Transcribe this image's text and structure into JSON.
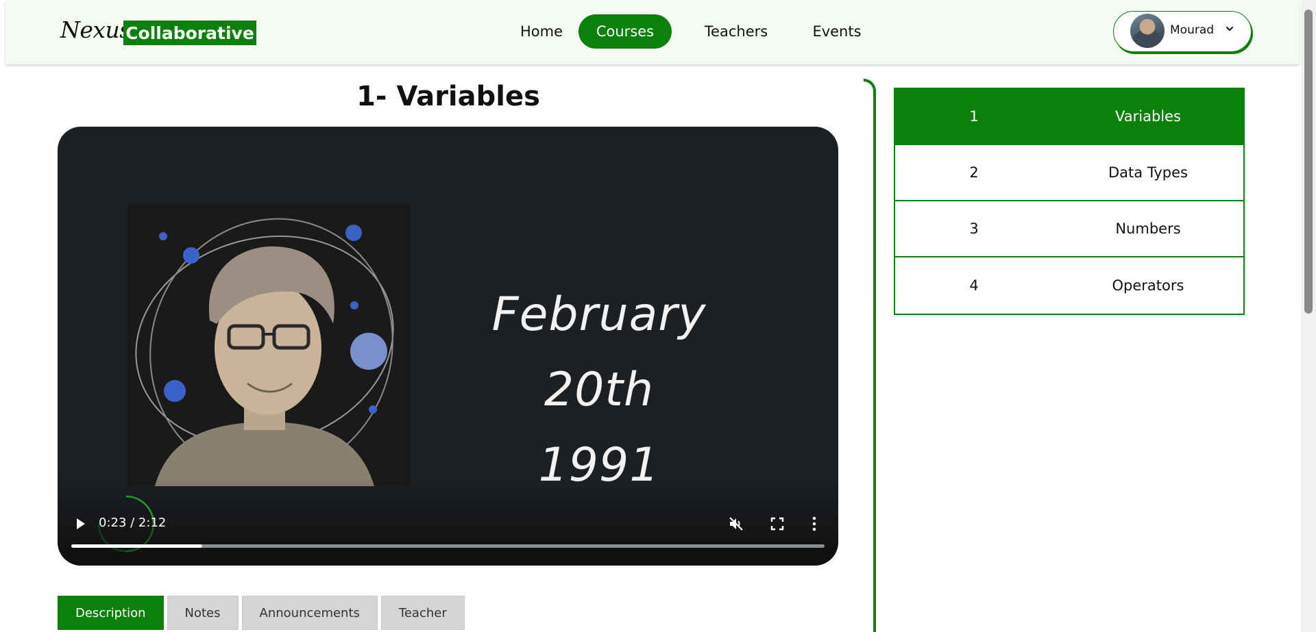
{
  "brand": {
    "script_text": "Nexus",
    "box_text": "Collaborative"
  },
  "nav": {
    "items": [
      {
        "label": "Home"
      },
      {
        "label": "Courses"
      },
      {
        "label": "Teachers"
      },
      {
        "label": "Events"
      }
    ],
    "active": "Courses"
  },
  "user": {
    "name": "Mourad"
  },
  "lesson": {
    "title": "1- Variables"
  },
  "video": {
    "frame_text_line1": "February 20th",
    "frame_text_line2": "1991",
    "time": "0:23 / 2:12",
    "progress": 0.174
  },
  "tabs": [
    {
      "label": "Description"
    },
    {
      "label": "Notes"
    },
    {
      "label": "Announcements"
    },
    {
      "label": "Teacher"
    }
  ],
  "active_tab": "Description",
  "lessons": [
    {
      "num": "1",
      "name": "Variables"
    },
    {
      "num": "2",
      "name": "Data Types"
    },
    {
      "num": "3",
      "name": "Numbers"
    },
    {
      "num": "4",
      "name": "Operators"
    }
  ],
  "colors": {
    "accent": "#0b800b",
    "video_bg": "#1d2023",
    "tab_inactive": "#d5d5d5"
  }
}
